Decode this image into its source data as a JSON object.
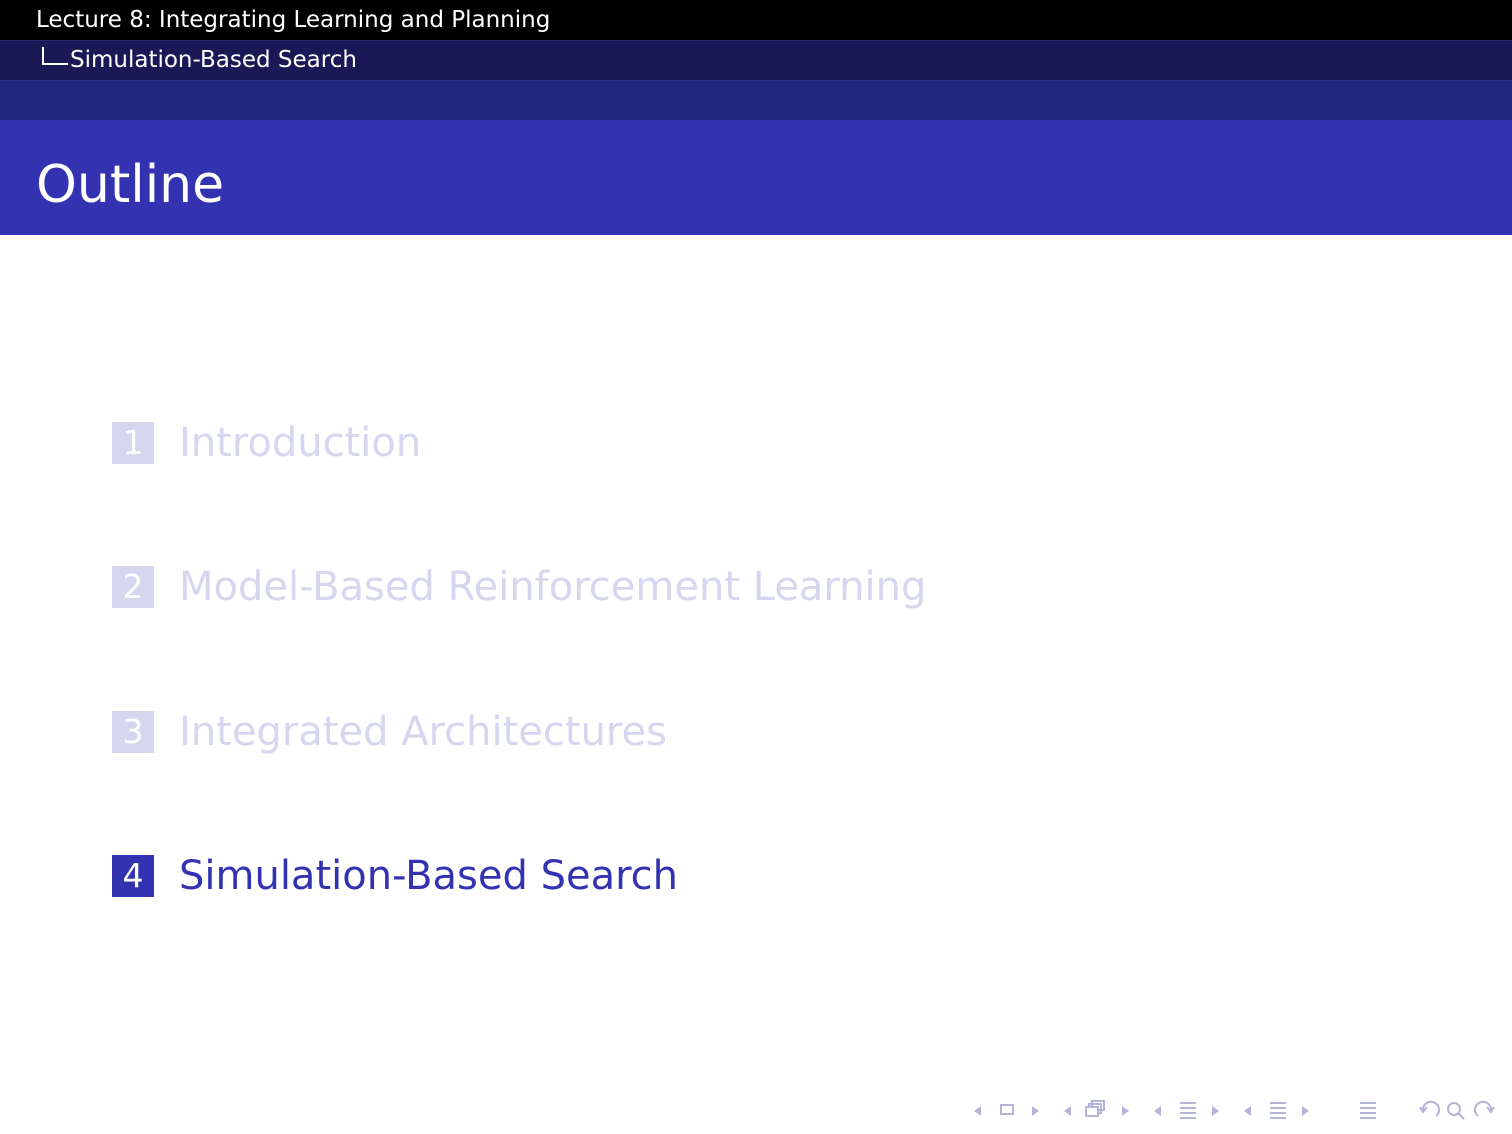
{
  "header": {
    "lecture_title": "Lecture 8: Integrating Learning and Planning",
    "section_title": "Simulation-Based Search"
  },
  "frame": {
    "title": "Outline"
  },
  "toc": {
    "items": [
      {
        "number": "1",
        "label": "Introduction",
        "state": "inactive"
      },
      {
        "number": "2",
        "label": "Model-Based Reinforcement Learning",
        "state": "inactive"
      },
      {
        "number": "3",
        "label": "Integrated Architectures",
        "state": "inactive"
      },
      {
        "number": "4",
        "label": "Simulation-Based Search",
        "state": "active"
      }
    ]
  },
  "colors": {
    "header_bg": "#000000",
    "subheader_bg": "#191a55",
    "band_bg": "#23267d",
    "title_bg": "#3333b2",
    "active": "#3333b2",
    "inactive": "#d6d6ef",
    "nav_symbols": "#b4b4d9"
  },
  "navigation": {
    "icons": [
      "prev-frame-arrow-icon",
      "frame-icon",
      "next-frame-arrow-icon",
      "prev-subsection-arrow-icon",
      "subsection-icon",
      "next-subsection-arrow-icon",
      "prev-section-arrow-icon",
      "section-icon",
      "next-section-arrow-icon",
      "prev-document-arrow-icon",
      "document-icon",
      "next-document-arrow-icon",
      "appendix-icon",
      "back-icon",
      "search-icon",
      "forward-icon"
    ]
  }
}
